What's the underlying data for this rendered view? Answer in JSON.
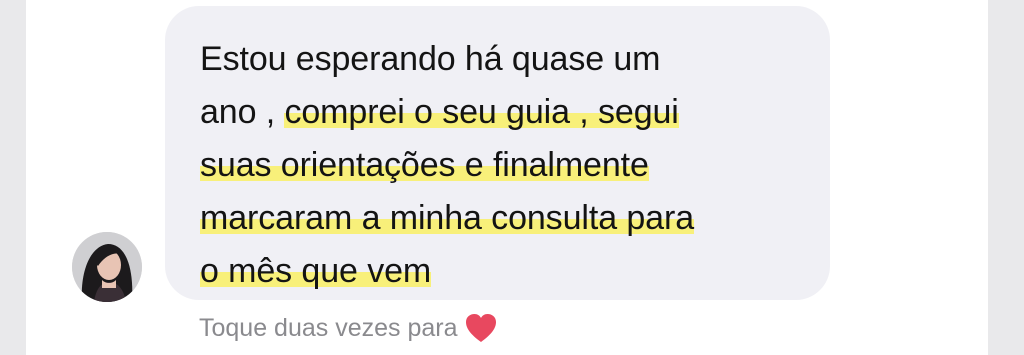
{
  "message": {
    "line1": "Estou esperando há quase um",
    "line2_plain": "ano , ",
    "line2_highlight": "comprei o seu guia , segui",
    "line3_highlight": "suas orientações e finalmente",
    "line4_highlight": "marcaram a minha consulta para",
    "line5_highlight": "o mês que vem"
  },
  "reaction_hint": {
    "label": "Toque duas vezes para",
    "icon": "heart-icon"
  },
  "colors": {
    "bubble": "#f0f0f5",
    "highlight": "#f8f07a",
    "heart": "#e8485f"
  }
}
